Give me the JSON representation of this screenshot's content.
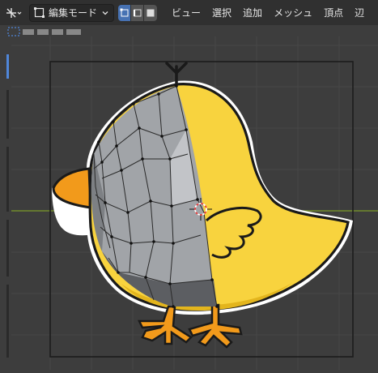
{
  "header": {
    "mode_label": "編集モード",
    "menus": [
      "ビュー",
      "選択",
      "追加",
      "メッシュ",
      "頂点",
      "辺"
    ]
  },
  "viewport": {
    "background": "#3d3d3d",
    "grid_color": "#474747",
    "x_axis_color": "#7d9b2a",
    "bird_body_color": "#f8d33e",
    "beak_color": "#f29a1b",
    "mesh_color": "#9ea1a5",
    "camera_frame_color": "#1c1c1c"
  },
  "icons": {
    "transform": "transform-pivot-icon",
    "mode": "edit-mode-icon",
    "vertex": "vertex-select-icon",
    "edge": "edge-select-icon",
    "face": "face-select-icon",
    "cursor": "3d-cursor-icon"
  }
}
